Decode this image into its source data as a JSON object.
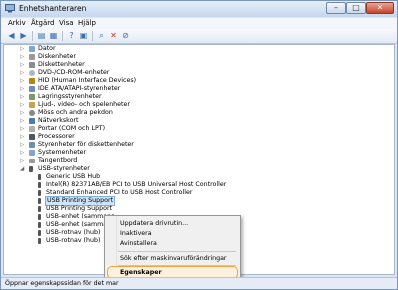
{
  "window": {
    "title": "Enhetshanteraren",
    "controls": {
      "minimize": "–",
      "maximize": "□",
      "close": "✕"
    }
  },
  "menu": [
    "Arkiv",
    "Åtgärd",
    "Visa",
    "Hjälp"
  ],
  "toolbar_icons": [
    "back-arrow-icon",
    "forward-arrow-icon",
    "properties-icon",
    "show-hide-icon",
    "help-icon",
    "computer-icon",
    "scan-hardware-icon",
    "uninstall-icon",
    "disable-icon"
  ],
  "tree": {
    "categories": [
      "Dator",
      "Diskenheter",
      "Diskettenheter",
      "DVD-/CD-ROM-enheter",
      "HID (Human Interface Devices)",
      "IDE ATA/ATAPI-styrenheter",
      "Lagringsstyrenheter",
      "Ljud-, video- och spelenheter",
      "Möss och andra pekdon",
      "Nätverkskort",
      "Portar (COM och LPT)",
      "Processorer",
      "Styrenheter för diskettenheter",
      "Systemenheter",
      "Tangentbord",
      "USB-styrenheter"
    ],
    "usb_children": [
      "Generic USB Hub",
      "Intel(R) 82371AB/EB PCI to USB Universal Host Controller",
      "Standard Enhanced PCI to USB Host Controller",
      "USB Printing Support",
      "USB Printing Support",
      "USB-enhet (sammans",
      "USB-enhet (sammans",
      "USB-rotnav (hub)",
      "USB-rotnav (hub)"
    ]
  },
  "context_menu": {
    "items": [
      "Uppdatera drivrutin...",
      "Inaktivera",
      "Avinstallera",
      "Sök efter maskinvaruförändringar",
      "Egenskaper"
    ],
    "highlighted": "Egenskaper",
    "highlight_color": "#f2a33a"
  },
  "status": {
    "text": "Öppnar egenskapssidan för det mar"
  }
}
